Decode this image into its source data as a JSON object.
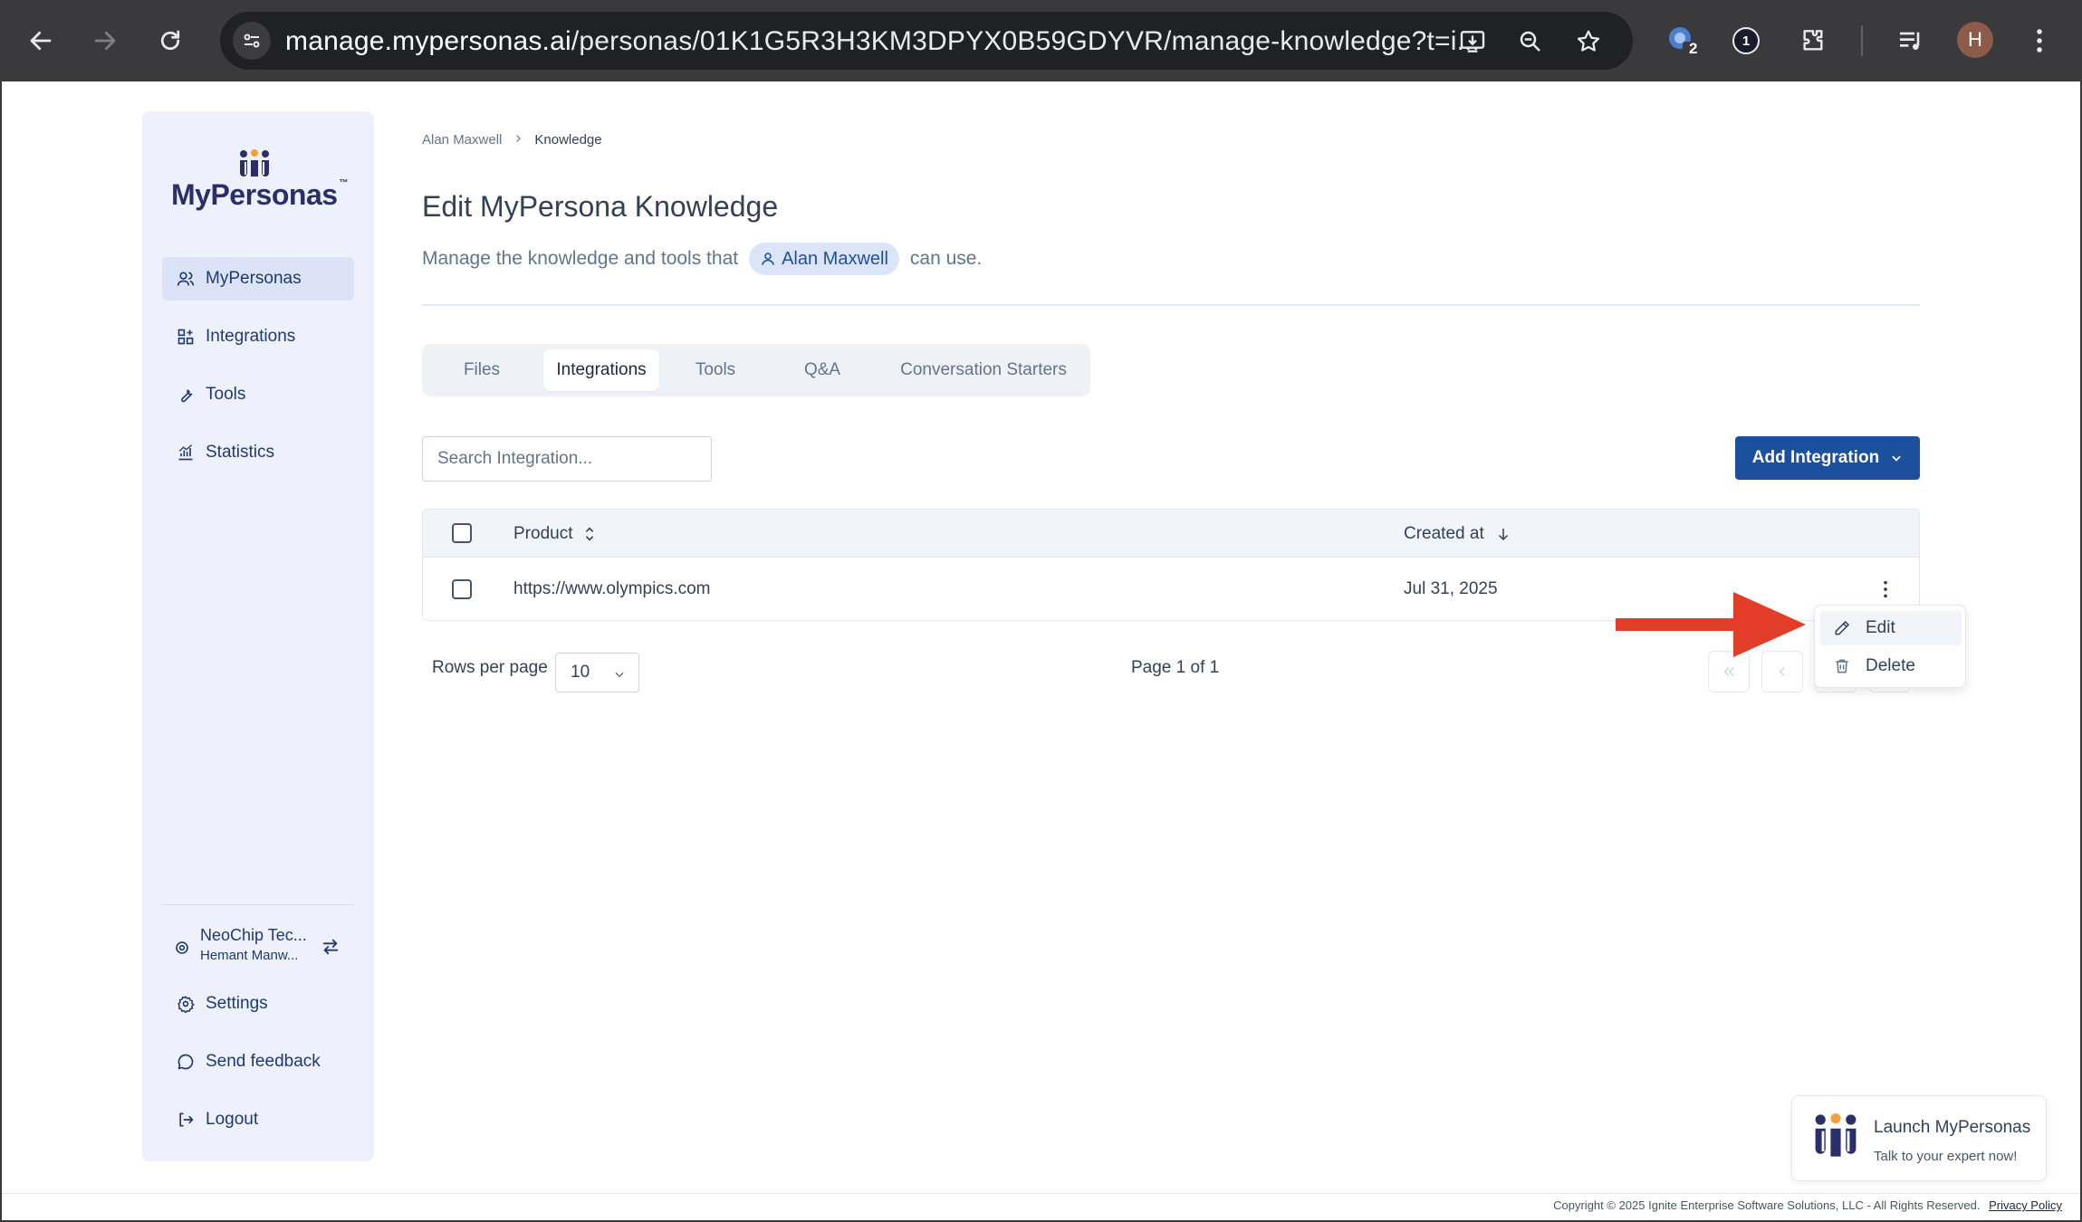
{
  "browser": {
    "url_host": "manage.mypersonas.ai",
    "url_path": "/personas/01K1G5R3H3KM3DPYX0B59GDYVR/manage-knowledge?t=i...",
    "extension_badge": "2",
    "password_ext_label": "1",
    "profile_initial": "H"
  },
  "sidebar": {
    "brand": "MyPersonas",
    "brand_tm": "™",
    "items": [
      {
        "label": "MyPersonas",
        "icon": "users-icon"
      },
      {
        "label": "Integrations",
        "icon": "integrations-icon"
      },
      {
        "label": "Tools",
        "icon": "wrench-icon"
      },
      {
        "label": "Statistics",
        "icon": "chart-icon"
      }
    ],
    "org": {
      "name": "NeoChip Tec...",
      "user": "Hemant Manw..."
    },
    "bottom_items": [
      {
        "label": "Settings",
        "icon": "gear-icon"
      },
      {
        "label": "Send feedback",
        "icon": "chat-icon"
      },
      {
        "label": "Logout",
        "icon": "logout-icon"
      }
    ]
  },
  "breadcrumb": {
    "parent": "Alan Maxwell",
    "current": "Knowledge"
  },
  "page": {
    "title": "Edit MyPersona Knowledge",
    "subtitle_before": "Manage the knowledge and tools that",
    "persona_name": "Alan Maxwell",
    "subtitle_after": "can use."
  },
  "tabs": [
    {
      "label": "Files",
      "active": false
    },
    {
      "label": "Integrations",
      "active": true
    },
    {
      "label": "Tools",
      "active": false
    },
    {
      "label": "Q&A",
      "active": false
    },
    {
      "label": "Conversation Starters",
      "active": false
    }
  ],
  "search": {
    "placeholder": "Search Integration..."
  },
  "add_button": {
    "label": "Add Integration"
  },
  "table": {
    "columns": [
      "Product",
      "Created at"
    ],
    "rows": [
      {
        "product": "https://www.olympics.com",
        "created_at": "Jul 31, 2025"
      }
    ]
  },
  "pagination": {
    "rows_label": "Rows per page",
    "rows_value": "10",
    "page_label": "Page 1 of 1"
  },
  "row_menu": {
    "items": [
      "Edit",
      "Delete"
    ]
  },
  "launch_widget": {
    "title": "Launch MyPersonas",
    "subtitle": "Talk to your expert now!"
  },
  "footer": {
    "copyright": "Copyright © 2025 Ignite Enterprise Software Solutions, LLC - All Rights Reserved.",
    "privacy": "Privacy Policy"
  },
  "colors": {
    "primary": "#1c4f9c",
    "arrow": "#e23d28",
    "sidebar_bg": "#eef1fb"
  }
}
